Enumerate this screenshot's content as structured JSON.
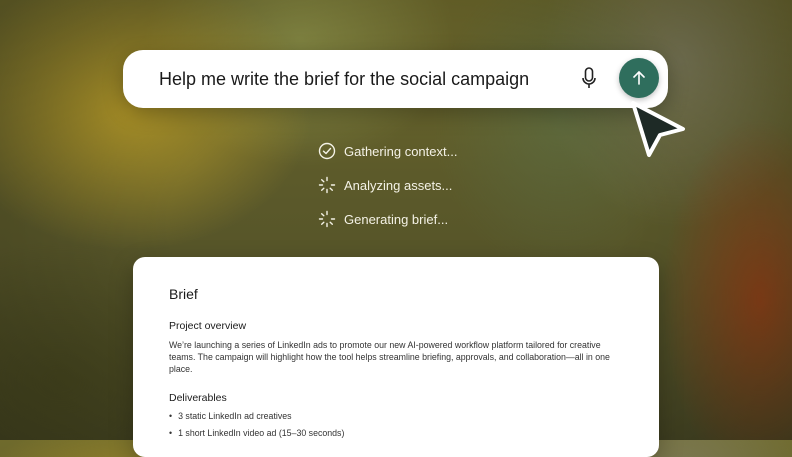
{
  "prompt": {
    "text": "Help me write the brief for the social campaign",
    "mic_icon": "microphone-icon",
    "send_icon": "arrow-up-icon",
    "accent_color": "#2f6e5d"
  },
  "status": [
    {
      "label": "Gathering context...",
      "icon": "check-circle-icon"
    },
    {
      "label": "Analyzing assets...",
      "icon": "spinner-icon"
    },
    {
      "label": "Generating brief...",
      "icon": "spinner-icon"
    }
  ],
  "brief": {
    "title": "Brief",
    "overview_heading": "Project overview",
    "overview_text": "We’re launching a series of LinkedIn ads to promote our new AI-powered workflow platform tailored for creative teams. The campaign will highlight how the tool helps streamline briefing, approvals, and collaboration—all in one place.",
    "deliverables_heading": "Deliverables",
    "deliverables": [
      "3 static LinkedIn ad creatives",
      "1 short LinkedIn video ad (15–30 seconds)"
    ]
  }
}
